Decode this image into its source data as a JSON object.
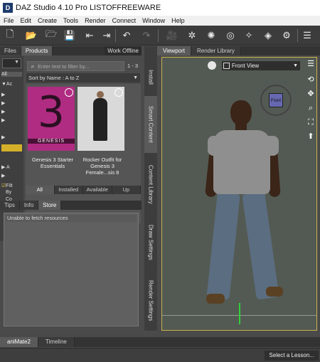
{
  "window": {
    "title": "DAZ Studio 4.10 Pro LISTOFFREEWARE",
    "icon_text": "D"
  },
  "menu": [
    "File",
    "Edit",
    "Create",
    "Tools",
    "Render",
    "Connect",
    "Window",
    "Help"
  ],
  "toolbar_icons": [
    "new-icon",
    "open-icon",
    "merge-icon",
    "save-icon",
    "import-icon",
    "export-icon",
    "undo-icon",
    "redo-icon",
    "camera-icon",
    "light-icon",
    "spotlight-icon",
    "point-light-icon",
    "distant-light-icon",
    "node-icon",
    "render-settings-icon",
    "window-icon"
  ],
  "left_panel": {
    "tabs": [
      "Files",
      "Products"
    ],
    "work_offline": "Work Offline",
    "category_labels": [
      "All",
      "▼Ac",
      "▶",
      "▶",
      "▶",
      "▶",
      "▶",
      "▶ A",
      "▶"
    ],
    "checkbox_labels": [
      "Filt",
      "By",
      "Co"
    ],
    "search_placeholder": "Enter text to filter by...",
    "count": "1 - 3",
    "sort": "Sort by Name : A to Z",
    "products": [
      {
        "name": "Genesis 3 Starter Essentials",
        "thumb_text": "3",
        "thumb_caption": "GENESIS"
      },
      {
        "name": "Rocker Outfit for Genesis 3 Female...sis 8"
      }
    ],
    "filter_tabs": [
      "All",
      "Installed",
      "Available",
      "Up"
    ],
    "lower_tabs": [
      "Tips",
      "Info",
      "Store"
    ],
    "store_message": "Unable to fetch resources"
  },
  "side_tabs": [
    "Install",
    "Smart Content",
    "Content Library",
    "Draw Settings",
    "Render Settings"
  ],
  "viewport": {
    "tabs": [
      "Viewport",
      "Render Library"
    ],
    "view": "Front View",
    "cube_label": "Front"
  },
  "bottom_tabs": [
    "aniMate2",
    "Timeline"
  ],
  "lesson_button": "Select a Lesson...",
  "colors": {
    "accent": "#c9b24a",
    "product_pink": "#b02c82",
    "axis_green": "#33d13a",
    "cube_face": "#6668b0"
  }
}
